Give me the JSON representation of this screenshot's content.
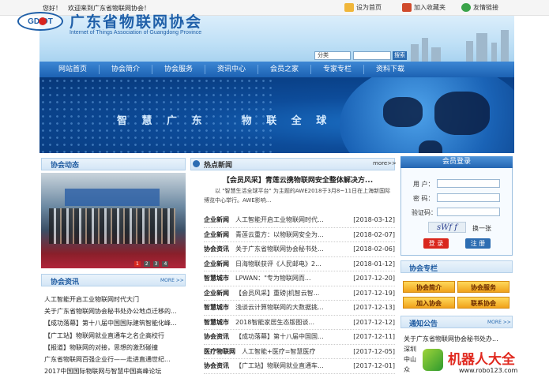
{
  "topbar": {
    "welcome": "您好！　欢迎来到广东省物联网协会！",
    "links": [
      {
        "label": "设为首页",
        "icon": "home-icon"
      },
      {
        "label": "加入收藏夹",
        "icon": "bookmark-icon"
      },
      {
        "label": "友情链接",
        "icon": "link-icon"
      }
    ]
  },
  "header": {
    "logo_text": "GDIOT",
    "title": "广东省物联网协会",
    "subtitle": "Internet of Things Association of Guangdong Province"
  },
  "search": {
    "category": "分类",
    "button": "搜索"
  },
  "nav": [
    "网站首页",
    "协会简介",
    "协会服务",
    "资讯中心",
    "会员之家",
    "专家专栏",
    "资料下载"
  ],
  "banner": {
    "text": "智 慧 广 东 　 物 联 全 球"
  },
  "activity": {
    "title": "协会动态",
    "slide_numbers": [
      "1",
      "2",
      "3",
      "4"
    ]
  },
  "hot_news": {
    "title": "热点新闻",
    "more": "more>>",
    "feature_title": "【会员风采】青莲云携物联网安全整体解决方...",
    "feature_summary": "以 \"智慧生活全球平台\" 为主题的AWE2018于3月8~11日在上海新国际博览中心举行。AWE影响...",
    "items": [
      {
        "category": "企业新闻",
        "title": "人工智能开启工业物联网时代...",
        "date": "[2018-03-12]"
      },
      {
        "category": "企业新闻",
        "title": "青莲云重方：以物联网安全为...",
        "date": "[2018-02-07]"
      },
      {
        "category": "协会资讯",
        "title": "关于广东省物联网协会秘书处...",
        "date": "[2018-02-06]"
      },
      {
        "category": "企业新闻",
        "title": "日海物联获评《人民邮电》2...",
        "date": "[2018-01-12]"
      },
      {
        "category": "智慧城市",
        "title": "LPWAN：\"专为物联网而...",
        "date": "[2017-12-20]"
      },
      {
        "category": "企业新闻",
        "title": "【会员风采】重磅|机智云智...",
        "date": "[2017-12-19]"
      },
      {
        "category": "智慧城市",
        "title": "浅谈云计算物联网的大数据挑...",
        "date": "[2017-12-13]"
      },
      {
        "category": "智慧城市",
        "title": "2018智能家居生态版图谈...",
        "date": "[2017-12-12]"
      },
      {
        "category": "协会资讯",
        "title": "【成功落幕】第十八届中国国...",
        "date": "[2017-12-11]"
      },
      {
        "category": "医疗物联网",
        "title": "人工智能+医疗=智慧医疗",
        "date": "[2017-12-05]"
      },
      {
        "category": "协会资讯",
        "title": "【广工站】物联网就业直通车...",
        "date": "[2017-12-01]"
      }
    ]
  },
  "association_news": {
    "title": "协会资讯",
    "more": "MORE >>",
    "items": [
      "人工智能开启工业物联网时代大门",
      "关于广东省物联网协会秘书处办公地点迁移的...",
      "【成功落幕】第十八届中国国际建筑智能化峰...",
      "【广工站】物联网就业直通车之名企高校行",
      "【报道】物联网的对接，思想的激烈碰撞",
      "广东省物联网百强企业行——走进直通世纪...",
      "2017中国国际物联网与智慧中国高峰论坛"
    ]
  },
  "login": {
    "title": "会员登录",
    "username_label": "用 户：",
    "password_label": "密 码：",
    "captcha_label": "验证码：",
    "captcha": "sWf f",
    "refresh": "换一张",
    "login_button": "登 录",
    "register_button": "注 册"
  },
  "association_column": {
    "title": "协会专栏",
    "buttons": [
      "协会简介",
      "协会服务",
      "加入协会",
      "联系协会"
    ]
  },
  "notice": {
    "title": "通知公告",
    "more": "MORE >>",
    "items": [
      "关于广东省物联网协会秘书处办...",
      "深圳",
      "中山",
      "众"
    ]
  },
  "watermark": {
    "text": "机器人大全",
    "url": "www.robo123.com"
  }
}
